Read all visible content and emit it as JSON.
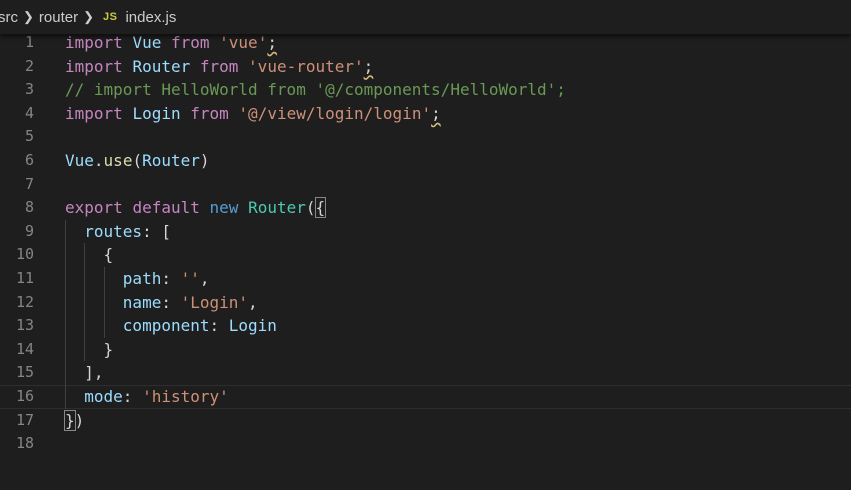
{
  "breadcrumb": {
    "items": [
      "src",
      "router"
    ],
    "file_badge": "JS",
    "file_name": "index.js"
  },
  "editor": {
    "language": "javascript",
    "line_numbers": [
      "1",
      "2",
      "3",
      "4",
      "5",
      "6",
      "7",
      "8",
      "9",
      "10",
      "11",
      "12",
      "13",
      "14",
      "15",
      "16",
      "17",
      "18"
    ],
    "current_line": 16,
    "lines": [
      [
        {
          "t": "import",
          "c": "kw-ctrl"
        },
        {
          "t": " "
        },
        {
          "t": "Vue",
          "c": "ident"
        },
        {
          "t": " "
        },
        {
          "t": "from",
          "c": "kw-ctrl"
        },
        {
          "t": " "
        },
        {
          "t": "'vue'",
          "c": "str"
        },
        {
          "t": ";",
          "c": "punc squig"
        }
      ],
      [
        {
          "t": "import",
          "c": "kw-ctrl"
        },
        {
          "t": " "
        },
        {
          "t": "Router",
          "c": "ident"
        },
        {
          "t": " "
        },
        {
          "t": "from",
          "c": "kw-ctrl"
        },
        {
          "t": " "
        },
        {
          "t": "'vue-router'",
          "c": "str"
        },
        {
          "t": ";",
          "c": "punc squig"
        }
      ],
      [
        {
          "t": "// import HelloWorld from '@/components/HelloWorld';",
          "c": "cmt"
        }
      ],
      [
        {
          "t": "import",
          "c": "kw-ctrl"
        },
        {
          "t": " "
        },
        {
          "t": "Login",
          "c": "ident"
        },
        {
          "t": " "
        },
        {
          "t": "from",
          "c": "kw-ctrl"
        },
        {
          "t": " "
        },
        {
          "t": "'@/view/login/login'",
          "c": "str"
        },
        {
          "t": ";",
          "c": "punc squig"
        }
      ],
      [],
      [
        {
          "t": "Vue",
          "c": "ident"
        },
        {
          "t": ".",
          "c": "punc"
        },
        {
          "t": "use",
          "c": "fn"
        },
        {
          "t": "(",
          "c": "punc"
        },
        {
          "t": "Router",
          "c": "ident"
        },
        {
          "t": ")",
          "c": "punc"
        }
      ],
      [],
      [
        {
          "t": "export",
          "c": "kw-ctrl"
        },
        {
          "t": " "
        },
        {
          "t": "default",
          "c": "kw-ctrl"
        },
        {
          "t": " "
        },
        {
          "t": "new",
          "c": "kw-blue"
        },
        {
          "t": " "
        },
        {
          "t": "Router",
          "c": "cls"
        },
        {
          "t": "(",
          "c": "punc"
        },
        {
          "t": "{",
          "c": "punc bracket-match"
        }
      ],
      [
        {
          "t": "  "
        },
        {
          "t": "routes",
          "c": "ident"
        },
        {
          "t": ": [",
          "c": "punc"
        }
      ],
      [
        {
          "t": "    "
        },
        {
          "t": "{",
          "c": "punc"
        }
      ],
      [
        {
          "t": "      "
        },
        {
          "t": "path",
          "c": "ident"
        },
        {
          "t": ": ",
          "c": "punc"
        },
        {
          "t": "''",
          "c": "str"
        },
        {
          "t": ",",
          "c": "punc"
        }
      ],
      [
        {
          "t": "      "
        },
        {
          "t": "name",
          "c": "ident"
        },
        {
          "t": ": ",
          "c": "punc"
        },
        {
          "t": "'Login'",
          "c": "str"
        },
        {
          "t": ",",
          "c": "punc"
        }
      ],
      [
        {
          "t": "      "
        },
        {
          "t": "component",
          "c": "ident"
        },
        {
          "t": ": ",
          "c": "punc"
        },
        {
          "t": "Login",
          "c": "ident"
        }
      ],
      [
        {
          "t": "    "
        },
        {
          "t": "}",
          "c": "punc"
        }
      ],
      [
        {
          "t": "  "
        },
        {
          "t": "],",
          "c": "punc"
        }
      ],
      [
        {
          "t": "  "
        },
        {
          "t": "mode",
          "c": "ident"
        },
        {
          "t": ": ",
          "c": "punc"
        },
        {
          "t": "'history'",
          "c": "str"
        }
      ],
      [
        {
          "t": "}",
          "c": "punc bracket-match"
        },
        {
          "t": ")",
          "c": "punc"
        }
      ],
      []
    ]
  }
}
